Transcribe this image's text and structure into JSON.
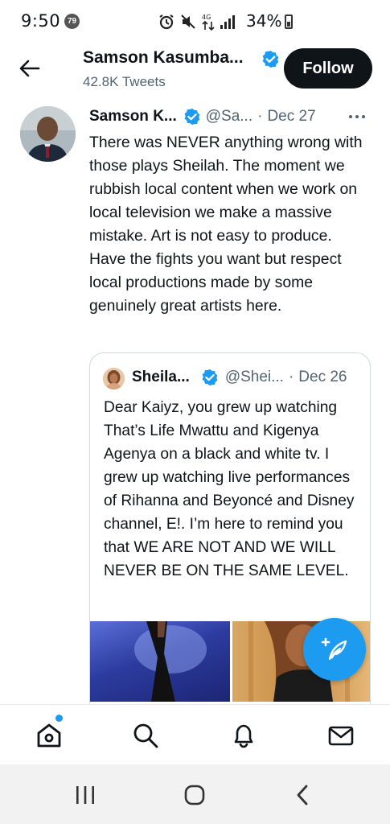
{
  "status_bar": {
    "time": "9:50",
    "notification_count": "79",
    "battery": "34%"
  },
  "header": {
    "title": "Samson Kasumba...",
    "subtitle": "42.8K Tweets",
    "follow_label": "Follow"
  },
  "tweet": {
    "name": "Samson K...",
    "handle": "@Sa...",
    "separator": "·",
    "date": "Dec 27",
    "text": "There was NEVER anything wrong with those plays Sheilah. The moment we rubbish local content when we work on local television we make a massive mistake. Art is not easy to produce. Have the fights you want but respect local productions made by some genuinely great artists here."
  },
  "quote": {
    "name": "Sheila...",
    "handle": "@Shei...",
    "separator": "·",
    "date": "Dec 26",
    "text": "Dear Kaiyz, you grew up watching That’s Life Mwattu and Kigenya Agenya on a black and white tv. I grew up watching live performances of Rihanna and Beyoncé and Disney channel, E!. I’m here to remind you that WE ARE NOT AND WE WILL NEVER BE ON THE SAME LEVEL."
  },
  "colors": {
    "accent": "#1d9bf0",
    "text": "#0f1419",
    "muted": "#536471"
  },
  "bottom_nav": {
    "items": [
      "home-icon",
      "search-icon",
      "notifications-icon",
      "messages-icon"
    ]
  },
  "system_nav": {
    "items": [
      "recents-icon",
      "home-circle-icon",
      "back-chevron-icon"
    ]
  }
}
